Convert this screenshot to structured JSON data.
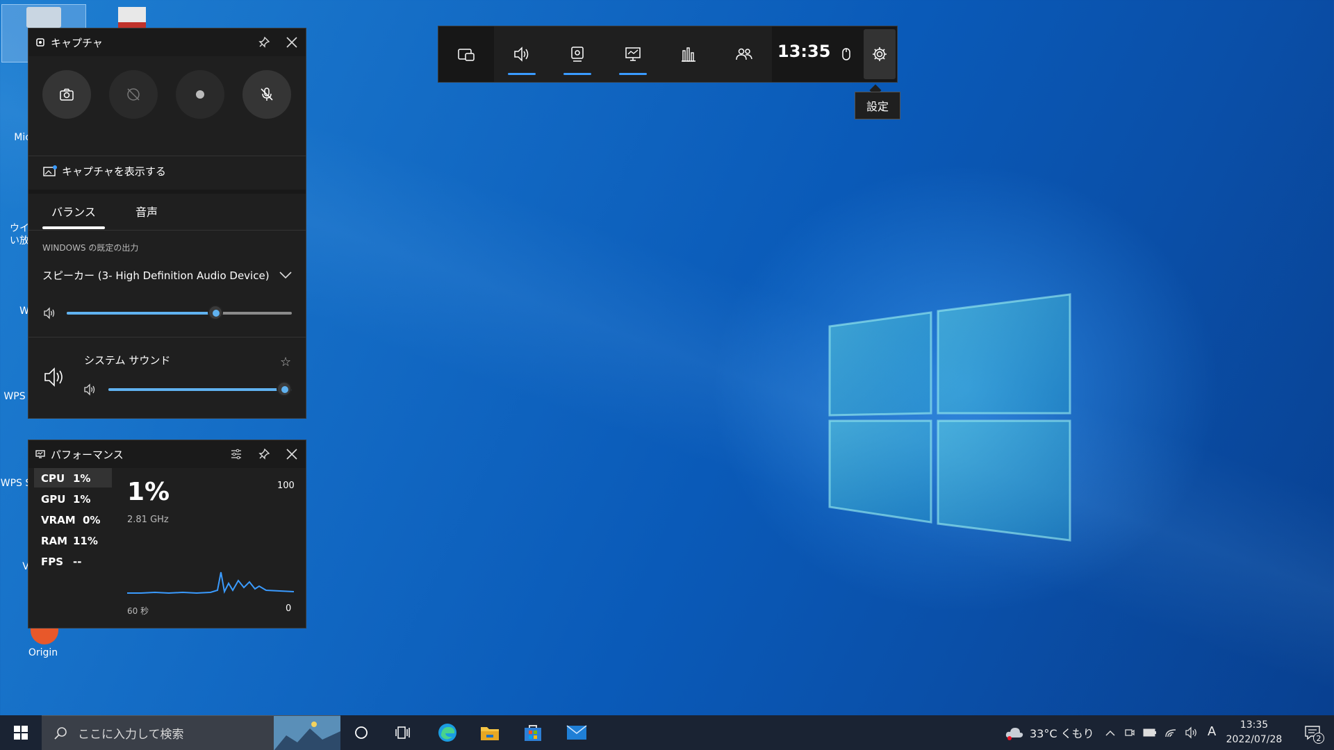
{
  "capture": {
    "title": "キャプチャ",
    "show_capture_label": "キャプチャを表示する"
  },
  "audio": {
    "tabs": [
      "バランス",
      "音声"
    ],
    "section_label": "WINDOWS の既定の出力",
    "device": "スピーカー (3- High Definition Audio Device)",
    "master_volume_fraction": 0.66,
    "app_name": "システム サウンド",
    "app_volume_fraction": 1.0
  },
  "performance": {
    "title": "パフォーマンス",
    "metrics": [
      {
        "name": "CPU",
        "value": "1%"
      },
      {
        "name": "GPU",
        "value": "1%"
      },
      {
        "name": "VRAM",
        "value": "0%"
      },
      {
        "name": "RAM",
        "value": "11%"
      },
      {
        "name": "FPS",
        "value": "--"
      }
    ],
    "big_value": "1%",
    "frequency": "2.81 GHz",
    "max_label": "100",
    "min_label": "0",
    "time_label": "60 秒"
  },
  "gamebar": {
    "time": "13:35",
    "tooltip": "設定"
  },
  "desktop": {
    "icon_labels": [
      "Micr",
      "ウイル",
      "い放題",
      "W",
      "WPS",
      "WPS S",
      "V",
      "Origin"
    ]
  },
  "taskbar": {
    "search_placeholder": "ここに入力して検索",
    "weather": "33°C くもり",
    "ime": "A",
    "clock_time": "13:35",
    "clock_date": "2022/07/28",
    "notification_count": "2"
  },
  "colors": {
    "accent": "#3a9bff",
    "panel_bg": "#1f1f1f",
    "slider_fill": "#60b2f0"
  }
}
